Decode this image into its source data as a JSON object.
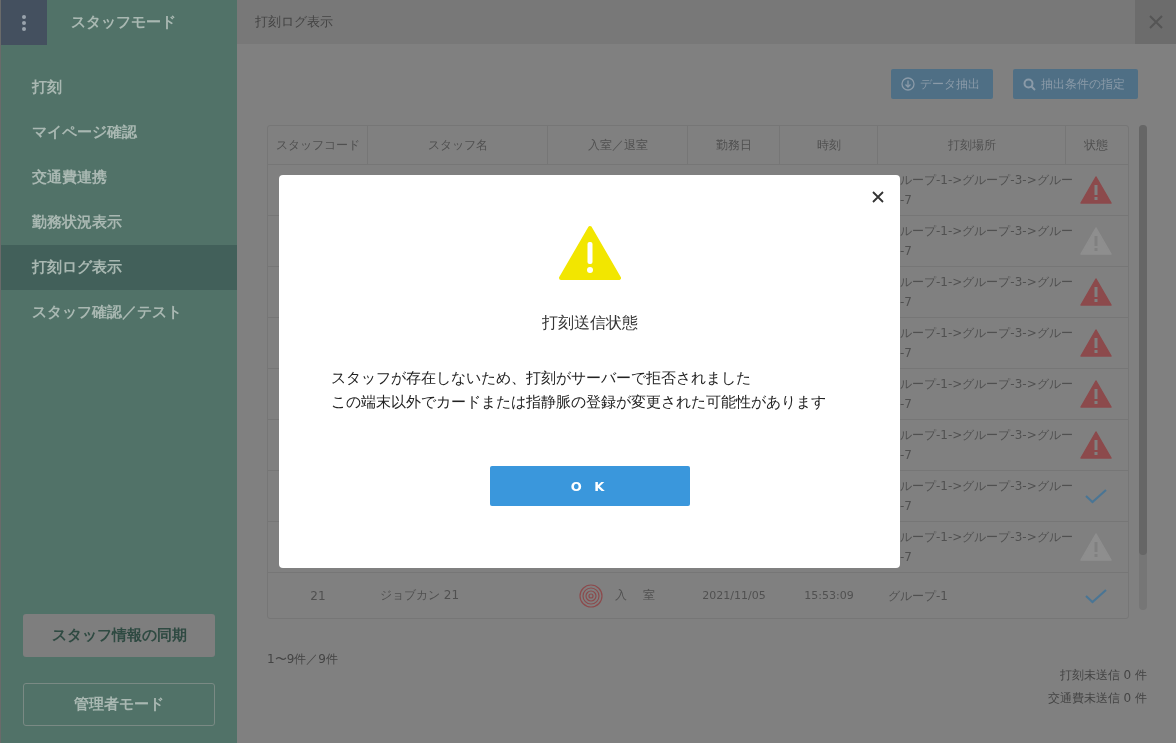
{
  "sidebar": {
    "title": "スタッフモード",
    "items": [
      {
        "label": "打刻",
        "selected": false
      },
      {
        "label": "マイページ確認",
        "selected": false
      },
      {
        "label": "交通費連携",
        "selected": false
      },
      {
        "label": "勤務状況表示",
        "selected": false
      },
      {
        "label": "打刻ログ表示",
        "selected": true
      },
      {
        "label": "スタッフ確認／テスト",
        "selected": false
      }
    ],
    "sync_button": "スタッフ情報の同期",
    "admin_button": "管理者モード"
  },
  "header": {
    "title": "打刻ログ表示"
  },
  "toolbar": [
    {
      "label": "データ抽出",
      "kind": "download"
    },
    {
      "label": "抽出条件の指定",
      "kind": "search"
    }
  ],
  "table": {
    "columns": [
      "スタッフコード",
      "スタッフ名",
      "入室／退室",
      "勤務日",
      "時刻",
      "打刻場所",
      "状態"
    ],
    "rows": [
      {
        "place": [
          "ループ-1->グループ-3->グルー",
          "-7"
        ],
        "kind": "error"
      },
      {
        "place": [
          "ループ-1->グループ-3->グルー",
          "-7"
        ],
        "kind": "pending"
      },
      {
        "place": [
          "ループ-1->グループ-3->グルー",
          "-7"
        ],
        "kind": "error"
      },
      {
        "place": [
          "ループ-1->グループ-3->グルー",
          "-7"
        ],
        "kind": "error"
      },
      {
        "place": [
          "ループ-1->グループ-3->グルー",
          "-7"
        ],
        "kind": "error"
      },
      {
        "place": [
          "ループ-1->グループ-3->グルー",
          "-7"
        ],
        "kind": "error"
      },
      {
        "place": [
          "ループ-1->グループ-3->グルー",
          "-7"
        ],
        "kind": "ok"
      },
      {
        "place": [
          "ループ-1->グループ-3->グルー",
          "-7"
        ],
        "kind": "pending"
      },
      {
        "code": "21",
        "name": "ジョブカン 21",
        "direction": "入　室",
        "date": "2021/11/05",
        "time": "15:53:09",
        "place": [
          "グループ-1"
        ],
        "kind": "ok"
      }
    ]
  },
  "pagination": "1〜9件／9件",
  "counters": [
    "打刻未送信 0 件",
    "交通費未送信 0 件"
  ],
  "dialog": {
    "title": "打刻送信状態",
    "message": [
      "スタッフが存在しないため、打刻がサーバーで拒否されました",
      "この端末以外でカードまたは指静脈の登録が変更された可能性があります"
    ],
    "button": "O K"
  }
}
